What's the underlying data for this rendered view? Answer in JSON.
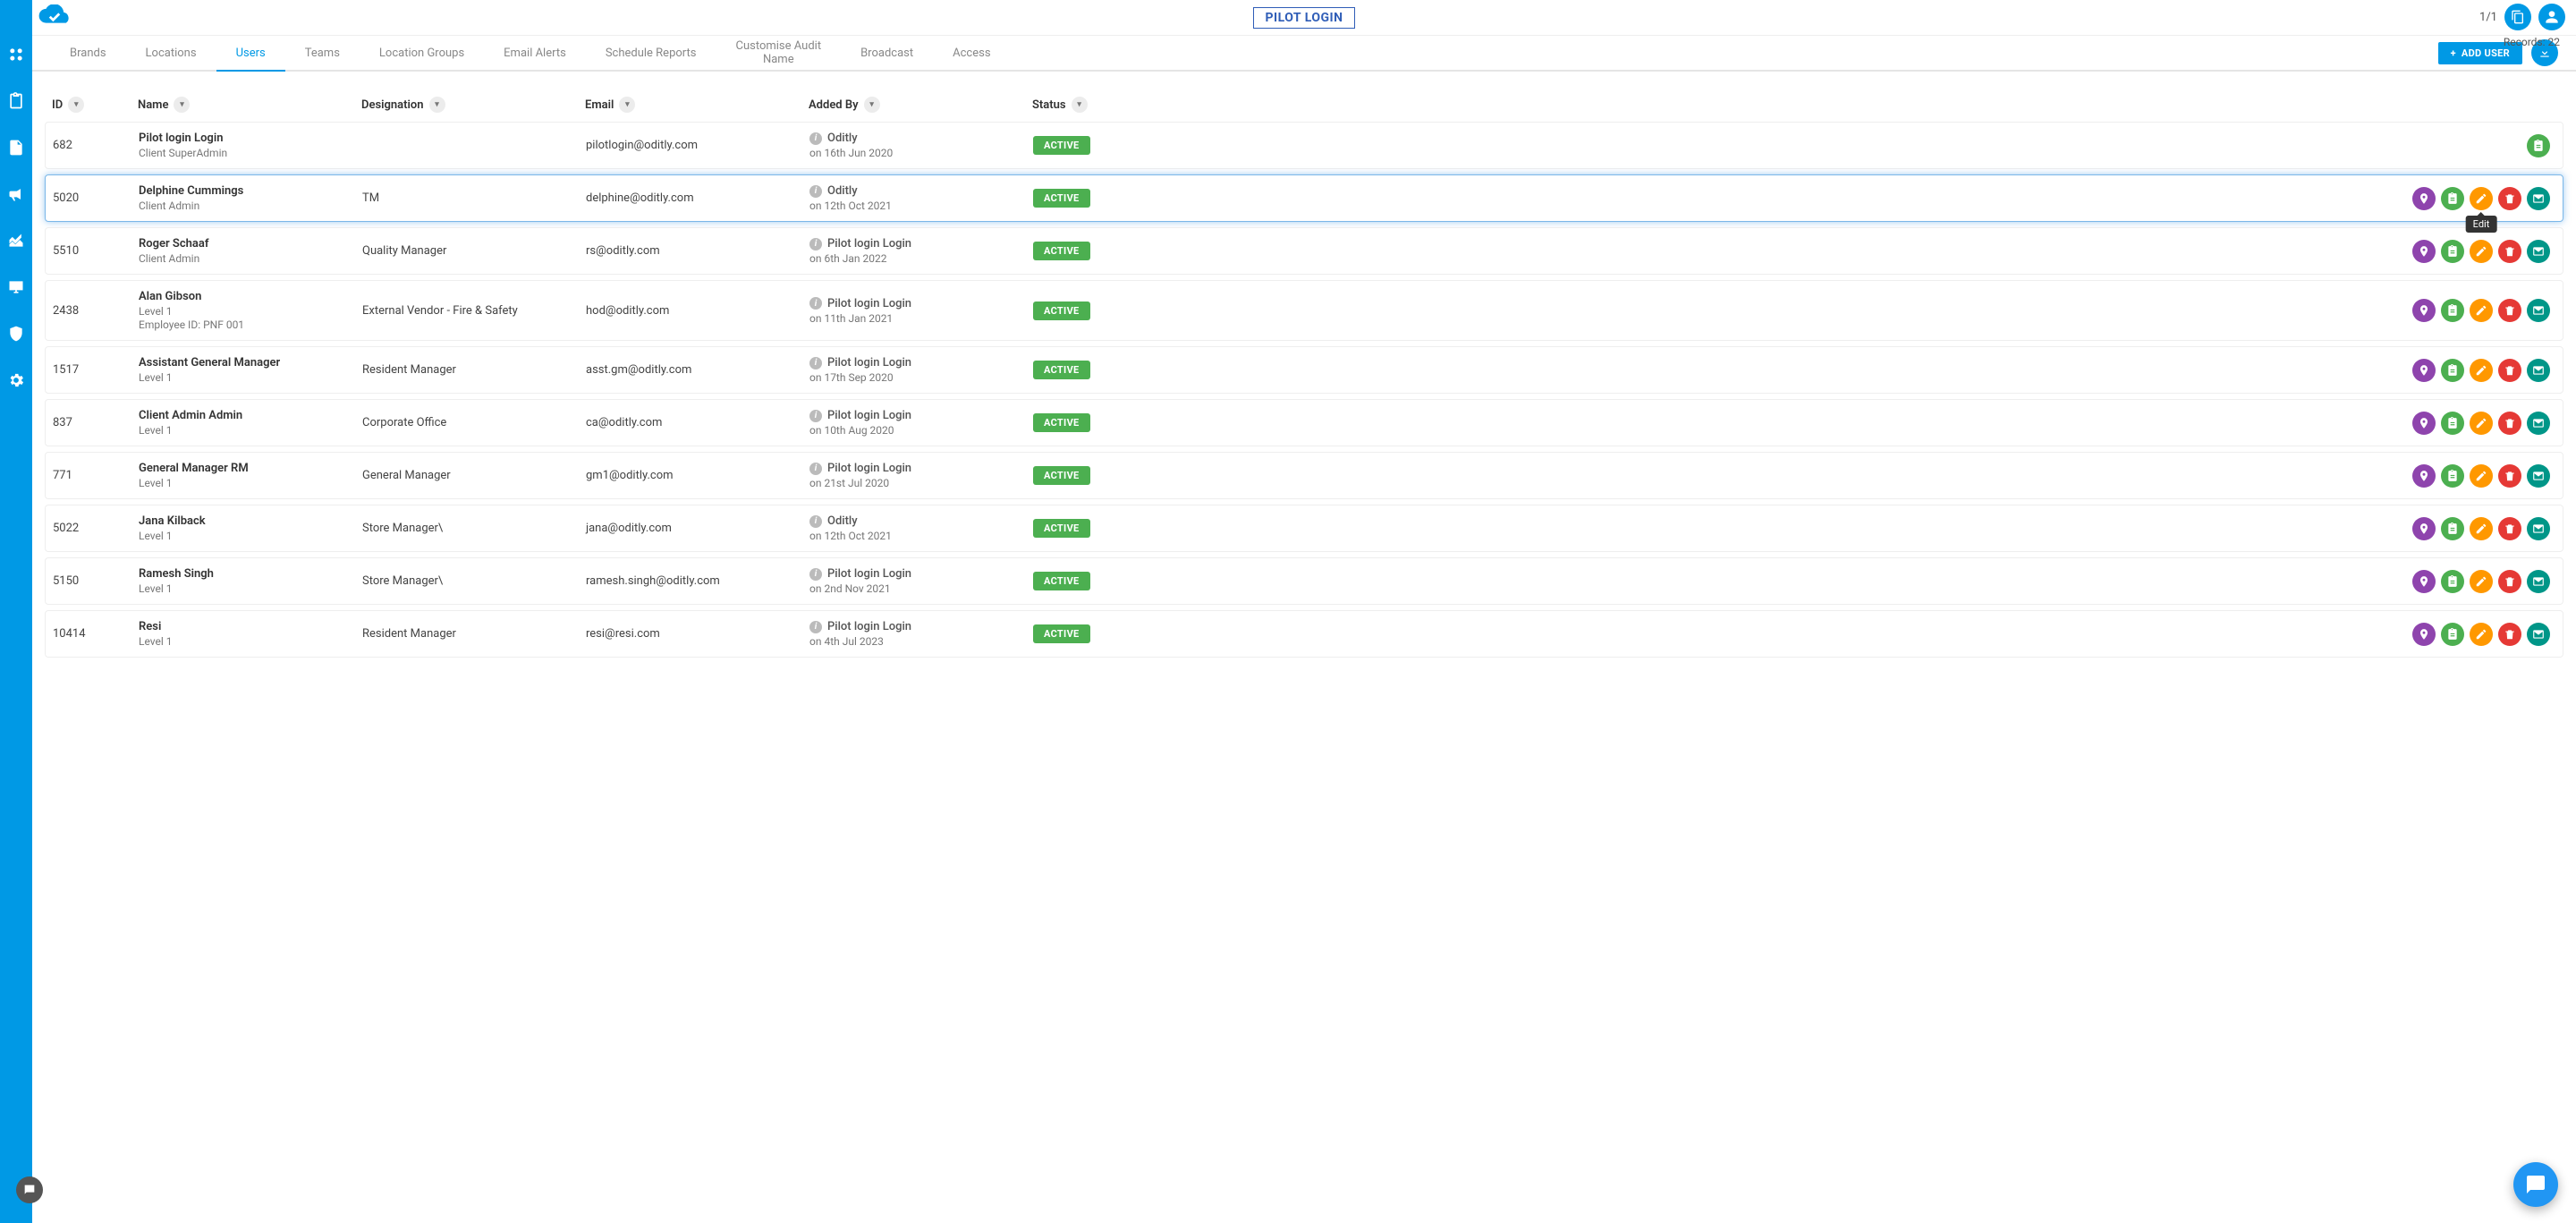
{
  "brand": "PILOT LOGIN",
  "pageCounter": "1/1",
  "addUserLabel": "ADD USER",
  "recordsLabel": "Records: 22",
  "editTooltip": "Edit",
  "nav": [
    {
      "label": "Brands"
    },
    {
      "label": "Locations"
    },
    {
      "label": "Users"
    },
    {
      "label": "Teams"
    },
    {
      "label": "Location Groups"
    },
    {
      "label": "Email Alerts"
    },
    {
      "label": "Schedule Reports"
    },
    {
      "label": "Customise Audit Name"
    },
    {
      "label": "Broadcast"
    },
    {
      "label": "Access"
    }
  ],
  "columns": {
    "id": "ID",
    "name": "Name",
    "designation": "Designation",
    "email": "Email",
    "addedBy": "Added By",
    "status": "Status"
  },
  "rows": [
    {
      "id": "682",
      "name": "Pilot login Login",
      "role": "Client SuperAdmin",
      "emp": "",
      "designation": "",
      "email": "pilotlogin@oditly.com",
      "addedBy": "Oditly",
      "addedOn": "on 16th Jun 2020",
      "status": "ACTIVE",
      "actions": [
        "form"
      ],
      "highlight": false
    },
    {
      "id": "5020",
      "name": "Delphine Cummings",
      "role": "Client Admin",
      "emp": "",
      "designation": "TM",
      "email": "delphine@oditly.com",
      "addedBy": "Oditly",
      "addedOn": "on 12th Oct 2021",
      "status": "ACTIVE",
      "actions": [
        "loc",
        "form",
        "edit",
        "del",
        "mail"
      ],
      "highlight": true,
      "showTooltip": true
    },
    {
      "id": "5510",
      "name": "Roger Schaaf",
      "role": "Client Admin",
      "emp": "",
      "designation": "Quality Manager",
      "email": "rs@oditly.com",
      "addedBy": "Pilot login Login",
      "addedOn": "on 6th Jan 2022",
      "status": "ACTIVE",
      "actions": [
        "loc",
        "form",
        "edit",
        "del",
        "mail"
      ],
      "highlight": false
    },
    {
      "id": "2438",
      "name": "Alan Gibson",
      "role": "Level 1",
      "emp": "Employee ID: PNF 001",
      "designation": "External Vendor - Fire & Safety",
      "email": "hod@oditly.com",
      "addedBy": "Pilot login Login",
      "addedOn": "on 11th Jan 2021",
      "status": "ACTIVE",
      "actions": [
        "loc",
        "form",
        "edit",
        "del",
        "mail"
      ],
      "highlight": false
    },
    {
      "id": "1517",
      "name": "Assistant General Manager",
      "role": "Level 1",
      "emp": "",
      "designation": "Resident Manager",
      "email": "asst.gm@oditly.com",
      "addedBy": "Pilot login Login",
      "addedOn": "on 17th Sep 2020",
      "status": "ACTIVE",
      "actions": [
        "loc",
        "form",
        "edit",
        "del",
        "mail"
      ],
      "highlight": false
    },
    {
      "id": "837",
      "name": "Client Admin Admin",
      "role": "Level 1",
      "emp": "",
      "designation": "Corporate Office",
      "email": "ca@oditly.com",
      "addedBy": "Pilot login Login",
      "addedOn": "on 10th Aug 2020",
      "status": "ACTIVE",
      "actions": [
        "loc",
        "form",
        "edit",
        "del",
        "mail"
      ],
      "highlight": false
    },
    {
      "id": "771",
      "name": "General Manager RM",
      "role": "Level 1",
      "emp": "",
      "designation": "General Manager",
      "email": "gm1@oditly.com",
      "addedBy": "Pilot login Login",
      "addedOn": "on 21st Jul 2020",
      "status": "ACTIVE",
      "actions": [
        "loc",
        "form",
        "edit",
        "del",
        "mail"
      ],
      "highlight": false
    },
    {
      "id": "5022",
      "name": "Jana Kilback",
      "role": "Level 1",
      "emp": "",
      "designation": "Store Manager\\",
      "email": "jana@oditly.com",
      "addedBy": "Oditly",
      "addedOn": "on 12th Oct 2021",
      "status": "ACTIVE",
      "actions": [
        "loc",
        "form",
        "edit",
        "del",
        "mail"
      ],
      "highlight": false
    },
    {
      "id": "5150",
      "name": "Ramesh Singh",
      "role": "Level 1",
      "emp": "",
      "designation": "Store Manager\\",
      "email": "ramesh.singh@oditly.com",
      "addedBy": "Pilot login Login",
      "addedOn": "on 2nd Nov 2021",
      "status": "ACTIVE",
      "actions": [
        "loc",
        "form",
        "edit",
        "del",
        "mail"
      ],
      "highlight": false
    },
    {
      "id": "10414",
      "name": "Resi",
      "role": "Level 1",
      "emp": "",
      "designation": "Resident Manager",
      "email": "resi@resi.com",
      "addedBy": "Pilot login Login",
      "addedOn": "on 4th Jul 2023",
      "status": "ACTIVE",
      "actions": [
        "loc",
        "form",
        "edit",
        "del",
        "mail"
      ],
      "highlight": false
    }
  ]
}
